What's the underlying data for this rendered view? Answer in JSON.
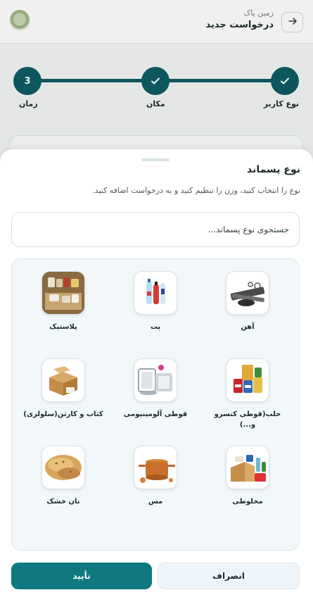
{
  "header": {
    "subtitle": "زمین پاک",
    "title": "درخواست جدید",
    "back_icon": "arrow-right-icon",
    "logo_icon": "app-logo-icon"
  },
  "stepper": {
    "steps": [
      {
        "label": "نوع کاربر",
        "state": "done"
      },
      {
        "label": "مکان",
        "state": "done"
      },
      {
        "label": "زمان",
        "state": "current",
        "number": "3"
      }
    ]
  },
  "sheet": {
    "title": "نوع پسماند",
    "description": "نوع را انتخاب کنید، وزن را تنظیم کنید و به درخواست اضافه کنید.",
    "search_placeholder": "جستجوی نوع پسماند...",
    "items": [
      {
        "label": "آهن",
        "icon": "iron-image"
      },
      {
        "label": "پت",
        "icon": "pet-bottles-image"
      },
      {
        "label": "پلاستیک",
        "icon": "plastic-image"
      },
      {
        "label": "حلب(قوطی کنسرو و...)",
        "icon": "tin-cans-image"
      },
      {
        "label": "قوطی آلومینیومی",
        "icon": "aluminum-cans-image"
      },
      {
        "label": "کتاب و کارتن(سلولزی)",
        "icon": "cardboard-image"
      },
      {
        "label": "مخلوطی",
        "icon": "mixed-waste-image"
      },
      {
        "label": "مس",
        "icon": "copper-image"
      },
      {
        "label": "نان خشک",
        "icon": "dry-bread-image"
      }
    ],
    "confirm_label": "تأیید",
    "cancel_label": "انصراف"
  },
  "colors": {
    "primary": "#0e7a7f",
    "stepper": "#0e5c63",
    "panel_bg": "#f2f7f9"
  }
}
